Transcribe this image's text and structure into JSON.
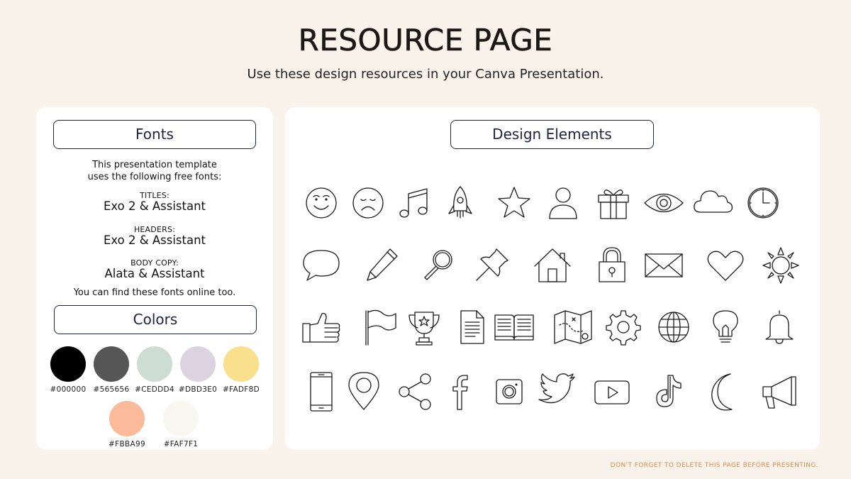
{
  "page": {
    "title": "RESOURCE PAGE",
    "subtitle": "Use these design resources in your Canva Presentation.",
    "footer_note": "DON'T FORGET TO DELETE THIS PAGE BEFORE PRESENTING."
  },
  "fonts_panel": {
    "heading": "Fonts",
    "intro_line1": "This presentation template",
    "intro_line2": "uses the following free fonts:",
    "titles_label": "TITLES:",
    "titles_fonts": "Exo 2 & Assistant",
    "headers_label": "HEADERS:",
    "headers_fonts": "Exo 2 & Assistant",
    "body_label": "BODY COPY:",
    "body_fonts": "Alata & Assistant",
    "online_note": "You can find these fonts online too."
  },
  "colors_panel": {
    "heading": "Colors",
    "swatches": [
      {
        "label": "#000000",
        "color": "#000000"
      },
      {
        "label": "#565656",
        "color": "#565656"
      },
      {
        "label": "#CEDDD4",
        "color": "#CEDDD4"
      },
      {
        "label": "#DBD3E0",
        "color": "#DBD3E0"
      },
      {
        "label": "#FADF8D",
        "color": "#FADF8D"
      },
      {
        "label": "#FBBA99",
        "color": "#FBBA99"
      },
      {
        "label": "#FAF7F1",
        "color": "#FAF7F1"
      }
    ]
  },
  "design_panel": {
    "heading": "Design Elements",
    "icons": [
      "smile-icon",
      "sad-icon",
      "music-note-icon",
      "rocket-icon",
      "star-icon",
      "user-icon",
      "gift-icon",
      "eye-icon",
      "cloud-icon",
      "clock-icon",
      "speech-bubble-icon",
      "pencil-icon",
      "magnifier-icon",
      "pushpin-icon",
      "house-icon",
      "padlock-icon",
      "envelope-icon",
      "heart-icon",
      "sun-icon",
      "thumbs-up-icon",
      "flag-icon",
      "trophy-icon",
      "document-icon",
      "open-book-icon",
      "map-icon",
      "gear-icon",
      "globe-icon",
      "lightbulb-icon",
      "bell-icon",
      "phone-icon",
      "location-pin-icon",
      "share-icon",
      "facebook-icon",
      "instagram-icon",
      "twitter-icon",
      "youtube-icon",
      "tiktok-icon",
      "moon-icon",
      "megaphone-icon"
    ]
  }
}
